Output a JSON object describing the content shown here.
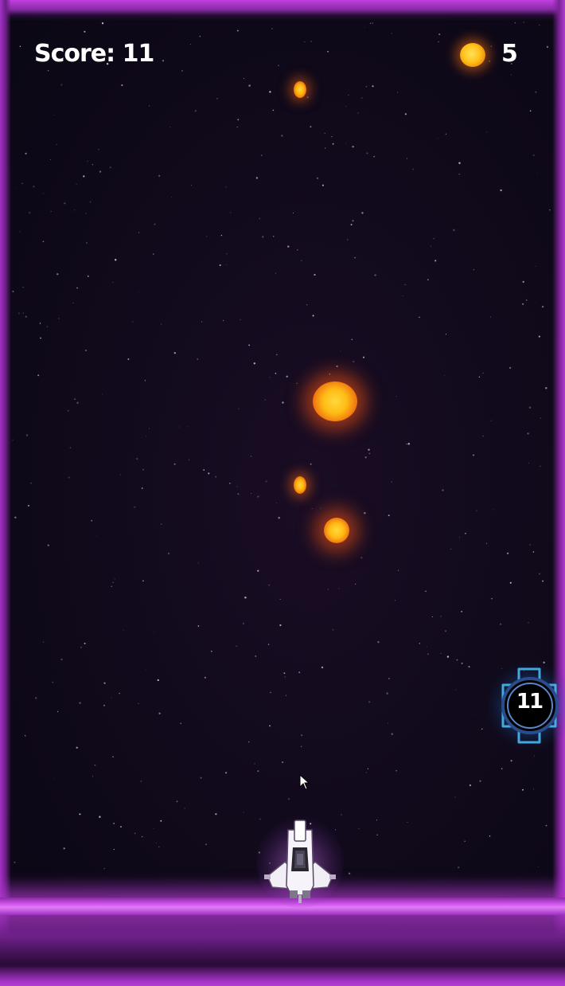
{
  "hud": {
    "score_text": "Score: 11",
    "coin_icon": "coin-icon",
    "coins": "5"
  },
  "powerup": {
    "icon": "shield-powerup-icon",
    "value": "11"
  },
  "colors": {
    "neon_border": "#c23ee0",
    "background": "#0f0a1a",
    "fireball": "#ffb512",
    "powerup_glow": "#36b6ff"
  }
}
